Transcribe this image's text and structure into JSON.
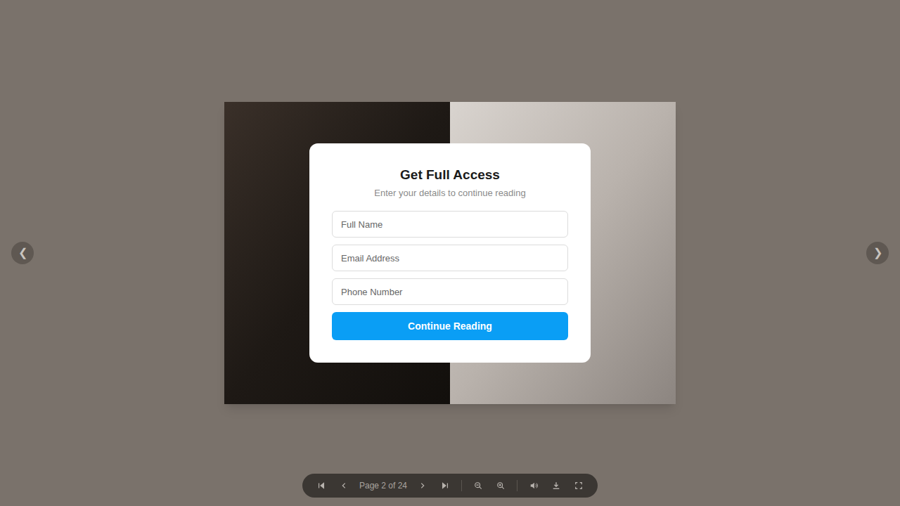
{
  "viewer": {
    "prev_arrow": "❮",
    "next_arrow": "❯"
  },
  "modal": {
    "title": "Get Full Access",
    "subtitle": "Enter your details to continue reading",
    "fields": [
      {
        "placeholder": "Full Name"
      },
      {
        "placeholder": "Email Address"
      },
      {
        "placeholder": "Phone Number"
      }
    ],
    "submit": "Continue Reading"
  },
  "toolbar": {
    "items": [
      {
        "kind": "first"
      },
      {
        "kind": "prev"
      },
      {
        "kind": "page",
        "text": "Page 2 of 24"
      },
      {
        "kind": "next"
      },
      {
        "kind": "last"
      },
      {
        "kind": "separator"
      },
      {
        "kind": "zoom-out"
      },
      {
        "kind": "zoom-in"
      },
      {
        "kind": "separator"
      },
      {
        "kind": "sound"
      },
      {
        "kind": "download"
      },
      {
        "kind": "fullscreen"
      }
    ]
  }
}
